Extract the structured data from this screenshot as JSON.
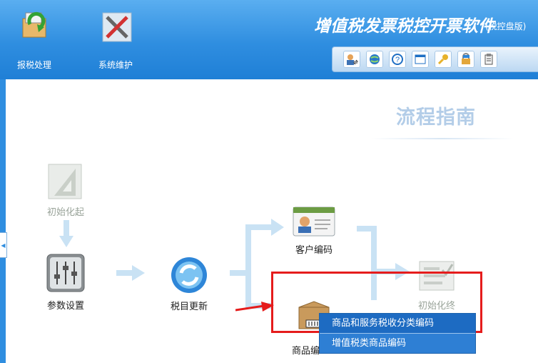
{
  "toolbar": {
    "buttons": [
      {
        "label": "报税处理",
        "icon": "tax-folder-icon"
      },
      {
        "label": "系统维护",
        "icon": "tools-icon"
      }
    ],
    "title": "增值税发票税控开票软件",
    "subtitle": "(税控盘版)",
    "icon_buttons": [
      "user-switch-icon",
      "globe-icon",
      "help-icon",
      "window-icon",
      "key-icon",
      "lock-icon",
      "clipboard-icon"
    ]
  },
  "guide": {
    "title": "流程指南",
    "steps": {
      "init_start": "初始化起",
      "params": "参数设置",
      "tax_update": "税目更新",
      "customer_code": "客户编码",
      "product_code": "商品编码",
      "product_code_visible": "商品编",
      "init_end": "初始化终"
    }
  },
  "context_menu": {
    "items": [
      "商品和服务税收分类编码",
      "增值税类商品编码"
    ]
  },
  "colors": {
    "header_blue": "#2f8ee0",
    "highlight_red": "#e51c1c",
    "menu_blue": "#2e7fd4"
  }
}
